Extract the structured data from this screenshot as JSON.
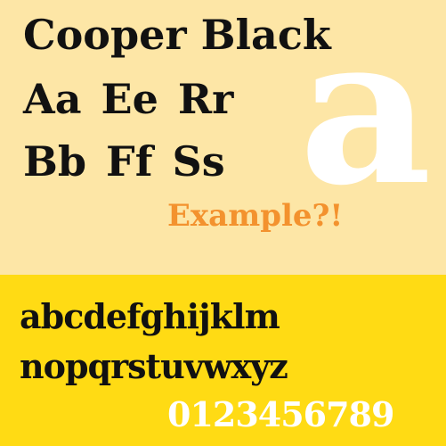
{
  "colors": {
    "top_background": "#FDE6A6",
    "bottom_background": "#FFDB14",
    "text_dark": "#111111",
    "accent_orange": "#F3922E",
    "white": "#FFFFFF"
  },
  "specimen": {
    "title": "Cooper Black",
    "row1": "Aa Ee Rr",
    "row2": "Bb Ff Ss",
    "big_glyph": "a",
    "example": "Example?!",
    "lowercase1": "abcdefghijklm",
    "lowercase2": "nopqrstuvwxyz",
    "digits": "0123456789"
  }
}
